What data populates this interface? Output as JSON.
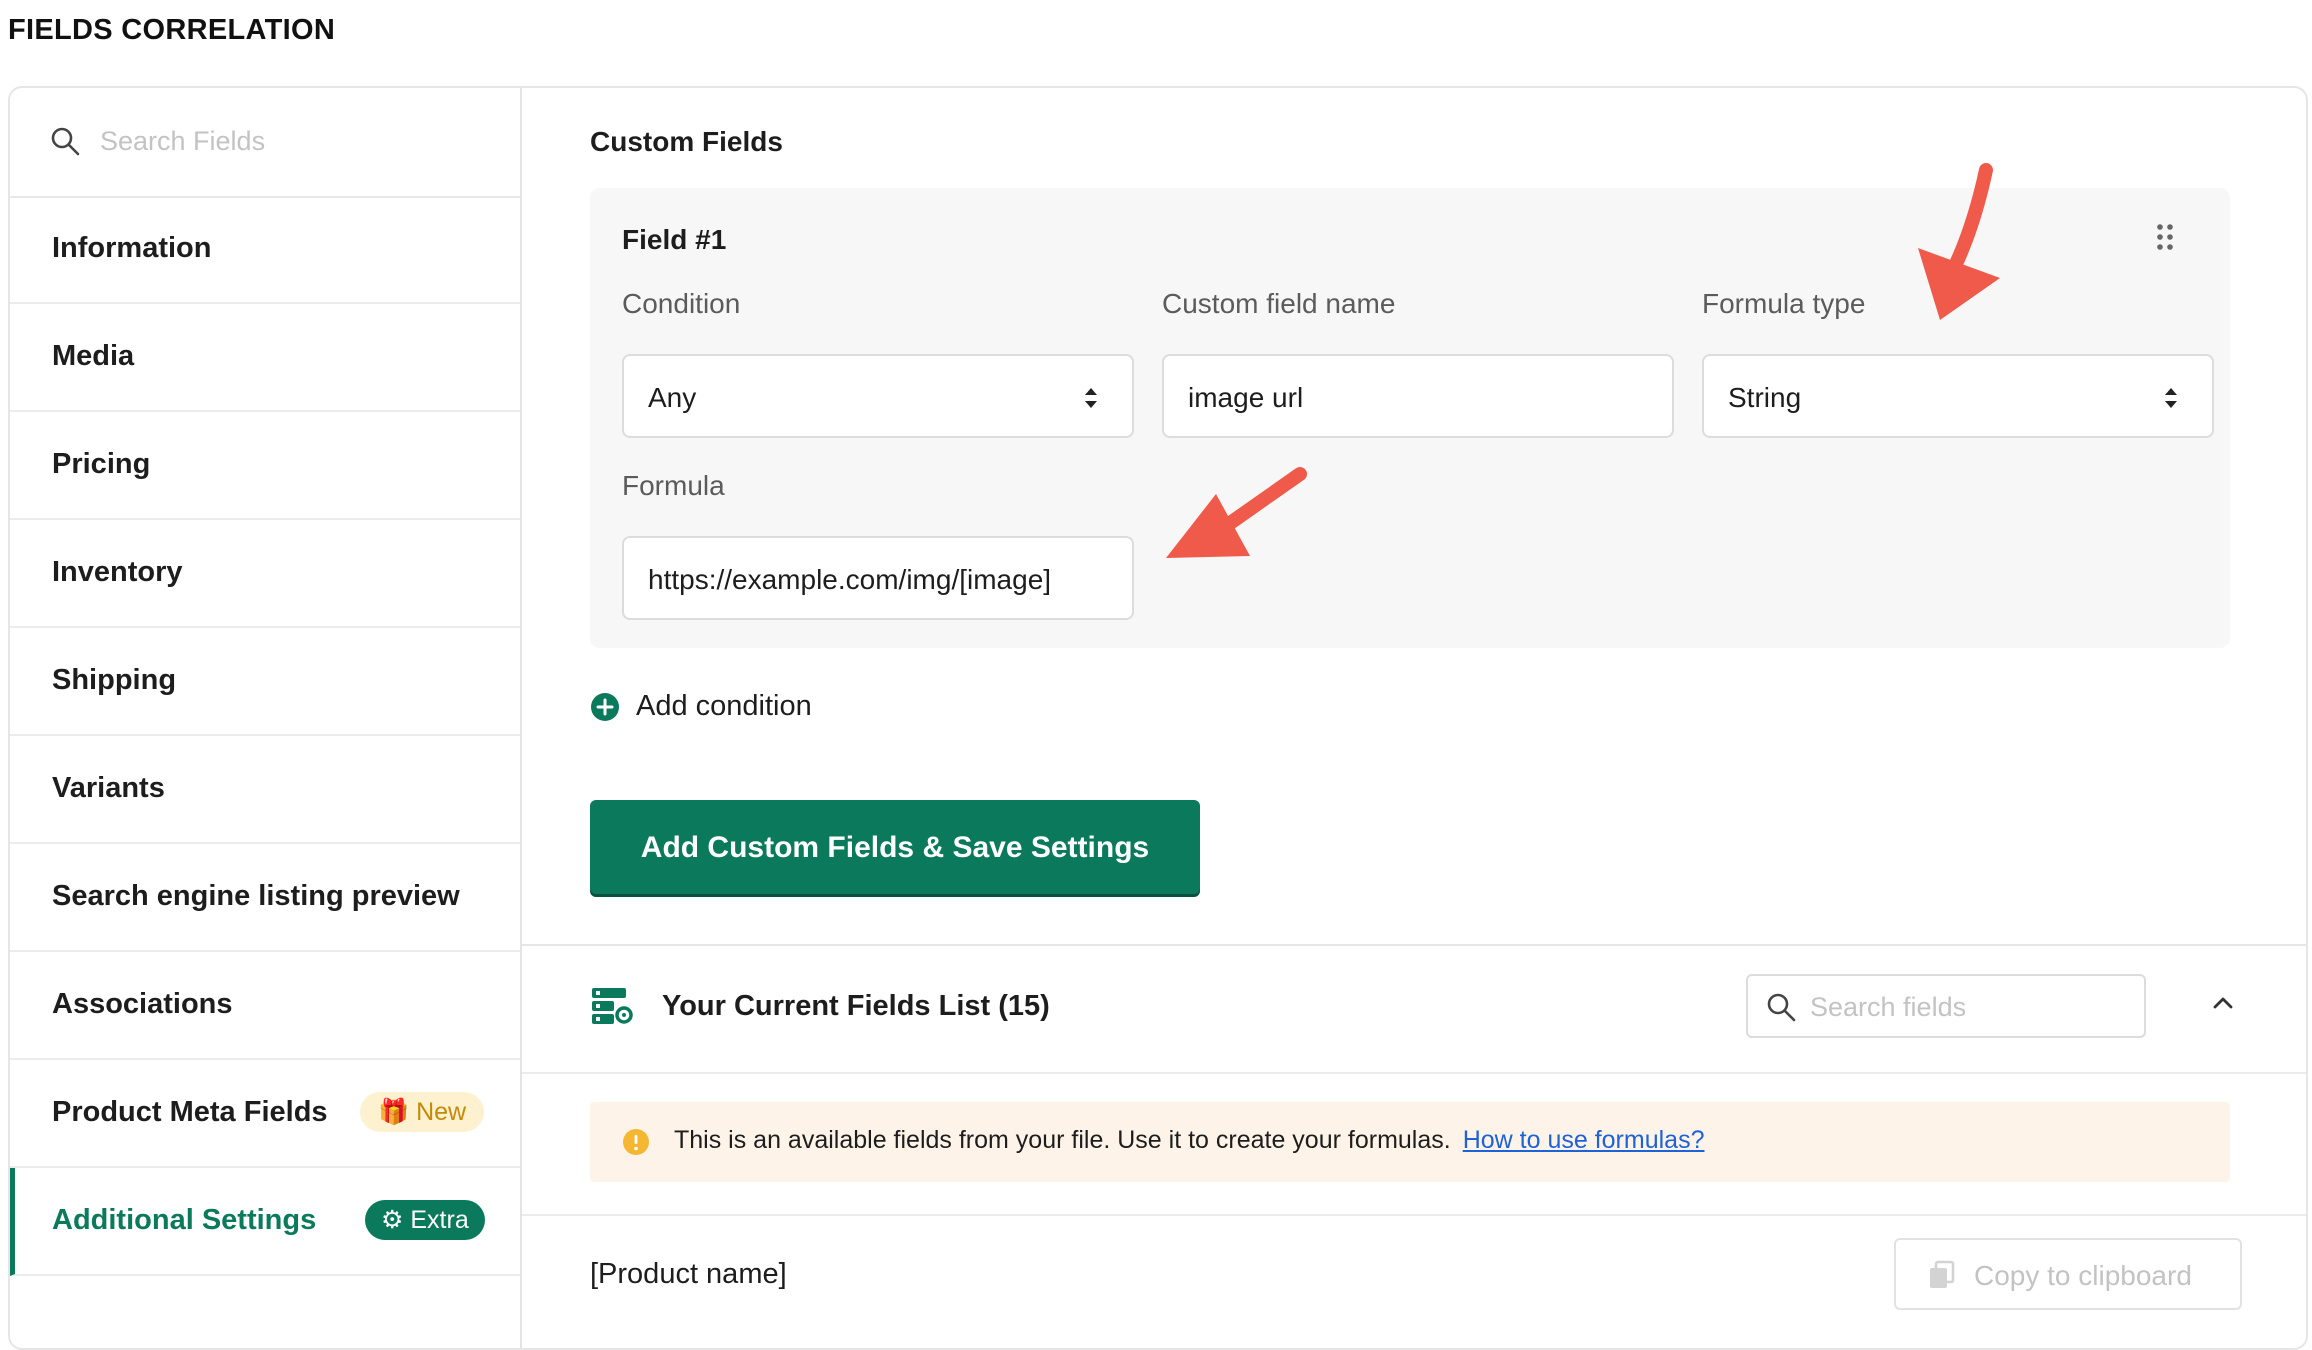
{
  "page": {
    "title": "FIELDS CORRELATION"
  },
  "sidebar": {
    "search_placeholder": "Search Fields",
    "items": [
      {
        "label": "Information"
      },
      {
        "label": "Media"
      },
      {
        "label": "Pricing"
      },
      {
        "label": "Inventory"
      },
      {
        "label": "Shipping"
      },
      {
        "label": "Variants"
      },
      {
        "label": "Search engine listing preview"
      },
      {
        "label": "Associations"
      },
      {
        "label": "Product Meta Fields",
        "badge": "New"
      },
      {
        "label": "Additional Settings",
        "badge": "Extra",
        "active": true
      }
    ]
  },
  "custom_fields": {
    "section_title": "Custom Fields",
    "field": {
      "title": "Field #1",
      "condition_label": "Condition",
      "condition_value": "Any",
      "name_label": "Custom field name",
      "name_value": "image url",
      "formula_type_label": "Formula type",
      "formula_type_value": "String",
      "formula_label": "Formula",
      "formula_value": "https://example.com/img/[image]"
    },
    "add_condition_label": "Add condition",
    "save_button_label": "Add Custom Fields & Save Settings"
  },
  "fields_list": {
    "title": "Your Current Fields List (15)",
    "search_placeholder": "Search fields",
    "info_text": "This is an available fields from your file. Use it to create your formulas.",
    "info_link": "How to use formulas?",
    "rows": [
      {
        "name": "[Product name]",
        "copy_label": "Copy to clipboard"
      }
    ]
  },
  "colors": {
    "accent": "#0b7a5c",
    "annotation_arrow": "#f05a4a",
    "link": "#1d62d6"
  }
}
